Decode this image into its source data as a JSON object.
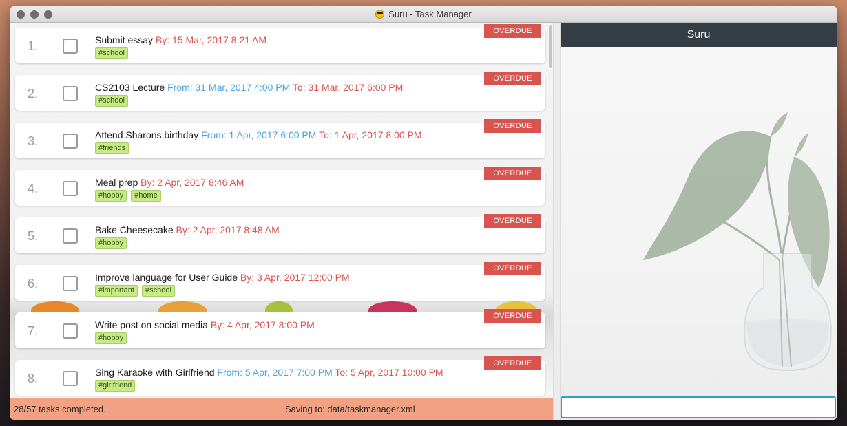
{
  "window": {
    "title": "Suru - Task Manager"
  },
  "tasks": [
    {
      "index": "1.",
      "name": "Submit essay",
      "segments": [
        {
          "text": "By: 15 Mar, 2017 8:21 AM",
          "color": "red"
        }
      ],
      "tags": [
        "#school"
      ],
      "status": "OVERDUE"
    },
    {
      "index": "2.",
      "name": "CS2103 Lecture",
      "segments": [
        {
          "text": "From: 31 Mar, 2017 4:00 PM",
          "color": "blue"
        },
        {
          "text": "To: 31 Mar, 2017 6:00 PM",
          "color": "red"
        }
      ],
      "tags": [
        "#school"
      ],
      "status": "OVERDUE"
    },
    {
      "index": "3.",
      "name": "Attend Sharons birthday",
      "segments": [
        {
          "text": "From: 1 Apr, 2017 6:00 PM",
          "color": "blue"
        },
        {
          "text": "To: 1 Apr, 2017 8:00 PM",
          "color": "red"
        }
      ],
      "tags": [
        "#friends"
      ],
      "status": "OVERDUE"
    },
    {
      "index": "4.",
      "name": "Meal prep",
      "segments": [
        {
          "text": "By: 2 Apr, 2017 8:46 AM",
          "color": "red"
        }
      ],
      "tags": [
        "#hobby",
        "#home"
      ],
      "status": "OVERDUE"
    },
    {
      "index": "5.",
      "name": "Bake Cheesecake",
      "segments": [
        {
          "text": "By: 2 Apr, 2017 8:48 AM",
          "color": "red"
        }
      ],
      "tags": [
        "#hobby"
      ],
      "status": "OVERDUE"
    },
    {
      "index": "6.",
      "name": "Improve language for User Guide",
      "segments": [
        {
          "text": "By: 3 Apr, 2017 12:00 PM",
          "color": "red"
        }
      ],
      "tags": [
        "#important",
        "#school"
      ],
      "status": "OVERDUE"
    },
    {
      "index": "7.",
      "name": "Write post on social media",
      "segments": [
        {
          "text": "By: 4 Apr, 2017 8:00 PM",
          "color": "red"
        }
      ],
      "tags": [
        "#hobby"
      ],
      "status": "OVERDUE"
    },
    {
      "index": "8.",
      "name": "Sing Karaoke with Girlfriend",
      "segments": [
        {
          "text": "From: 5 Apr, 2017 7:00 PM",
          "color": "blue"
        },
        {
          "text": "To: 5 Apr, 2017 10:00 PM",
          "color": "red"
        }
      ],
      "tags": [
        "#girlfriend"
      ],
      "status": "OVERDUE"
    }
  ],
  "status_bar": {
    "completed": "28/57 tasks completed.",
    "saving": "Saving to: data/taskmanager.xml"
  },
  "browser": {
    "title": "Suru"
  },
  "command_box": {
    "value": ""
  },
  "colors": {
    "overdue": "#d9534f",
    "deadline_red": "#d9534f",
    "start_blue": "#4aa3df",
    "tag_green": "#c7ea86",
    "status_bar": "#f2a283",
    "header_dark": "#343e44"
  }
}
